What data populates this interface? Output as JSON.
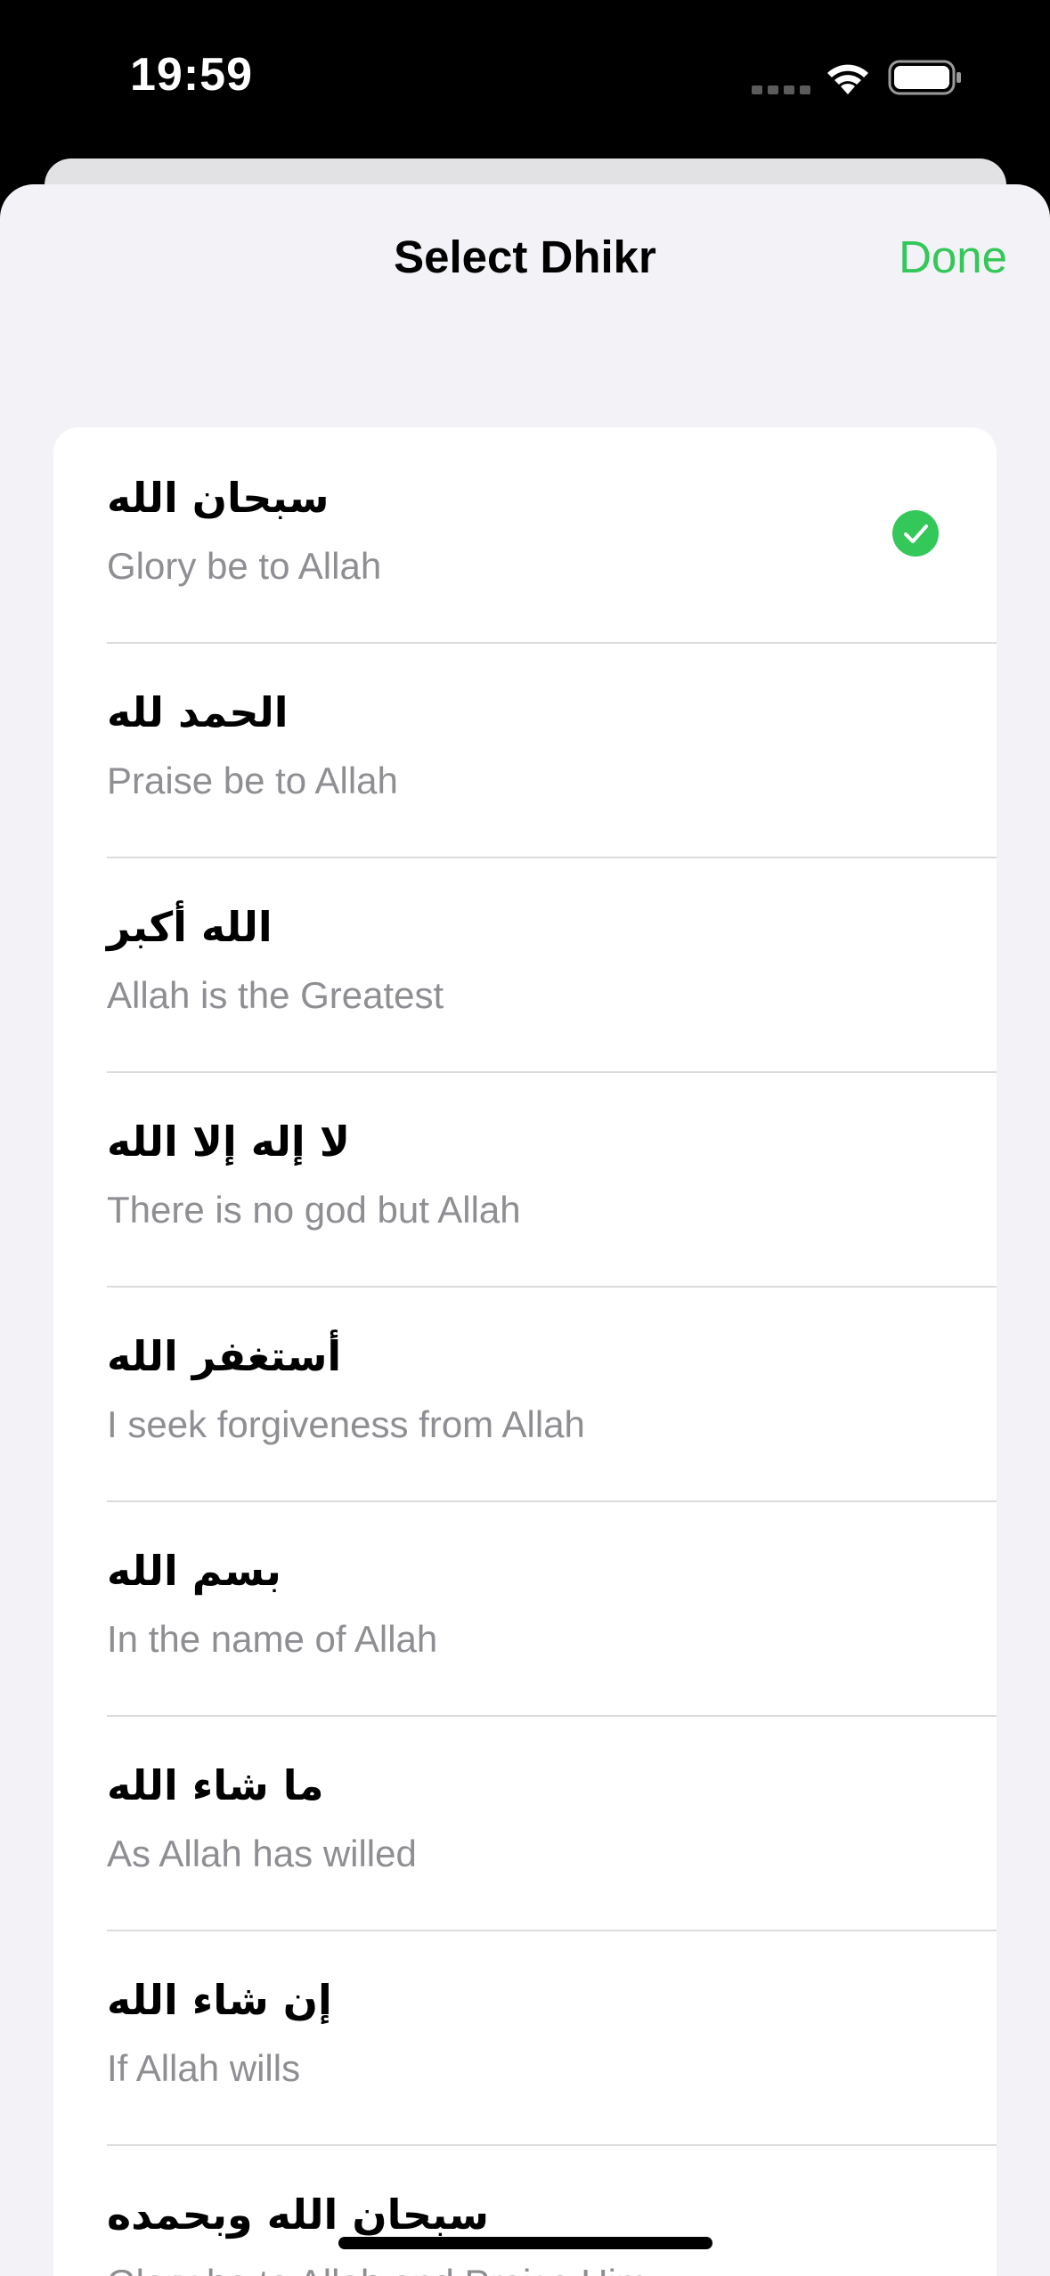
{
  "status_bar": {
    "time": "19:59"
  },
  "header": {
    "title": "Select Dhikr",
    "done_label": "Done"
  },
  "colors": {
    "accent": "#34c759",
    "secondary_text": "#8e8e93",
    "background": "#f2f2f7"
  },
  "dhikr_list": [
    {
      "arabic": "سبحان الله",
      "english": "Glory be to Allah",
      "selected": true
    },
    {
      "arabic": "الحمد لله",
      "english": "Praise be to Allah",
      "selected": false
    },
    {
      "arabic": "الله أكبر",
      "english": "Allah is the Greatest",
      "selected": false
    },
    {
      "arabic": "لا إله إلا الله",
      "english": "There is no god but Allah",
      "selected": false
    },
    {
      "arabic": "أستغفر الله",
      "english": "I seek forgiveness from Allah",
      "selected": false
    },
    {
      "arabic": "بسم الله",
      "english": "In the name of Allah",
      "selected": false
    },
    {
      "arabic": "ما شاء الله",
      "english": "As Allah has willed",
      "selected": false
    },
    {
      "arabic": "إن شاء الله",
      "english": "If Allah wills",
      "selected": false
    },
    {
      "arabic": "سبحان الله وبحمده",
      "english": "Glory be to Allah and Praise Him",
      "selected": false
    }
  ],
  "icons": {
    "wifi": "wifi-icon",
    "battery": "battery-icon",
    "check": "checkmark-circle-icon"
  }
}
